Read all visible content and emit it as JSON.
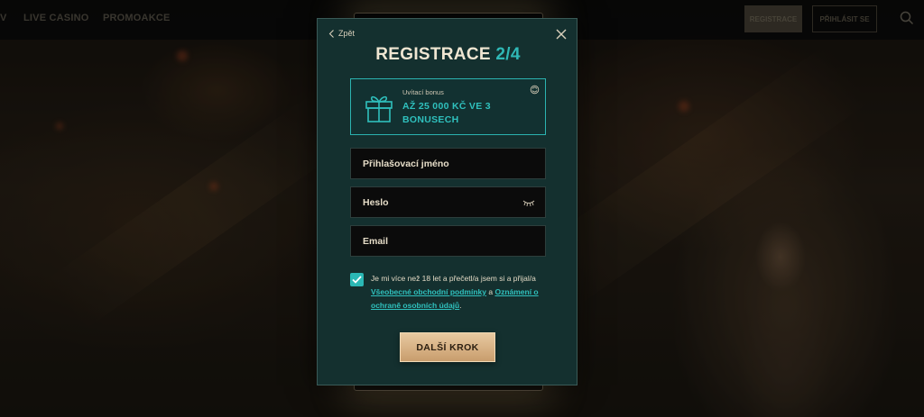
{
  "topbar": {
    "nav": [
      "V",
      "LIVE CASINO",
      "PROMOAKCE"
    ],
    "register_label": "REGISTRACE",
    "login_label": "PŘIHLÁSIT SE",
    "search_icon": "search-icon"
  },
  "modal": {
    "back_label": "Zpět",
    "title": "REGISTRACE",
    "step": "2/4",
    "bonus": {
      "label": "Uvítací bonus",
      "value": "AŽ 25 000 KČ VE 3 BONUSECH",
      "icon": "gift-icon"
    },
    "fields": {
      "username_placeholder": "Přihlašovací jméno",
      "password_placeholder": "Heslo",
      "email_placeholder": "Email"
    },
    "consent": {
      "checked": true,
      "text_before": "Je mi více než 18 let a přečetl/a jsem si a přijal/a ",
      "terms_link": "Všeobecné obchodní podmínky",
      "text_middle": " a ",
      "privacy_link": "Oznámení o ochraně osobních údajů",
      "text_after": "."
    },
    "next_label": "DALŠÍ KROK"
  },
  "colors": {
    "modal_bg": "#14302f",
    "accent_teal": "#2fb8b6",
    "button_gold": "#d9b584"
  }
}
